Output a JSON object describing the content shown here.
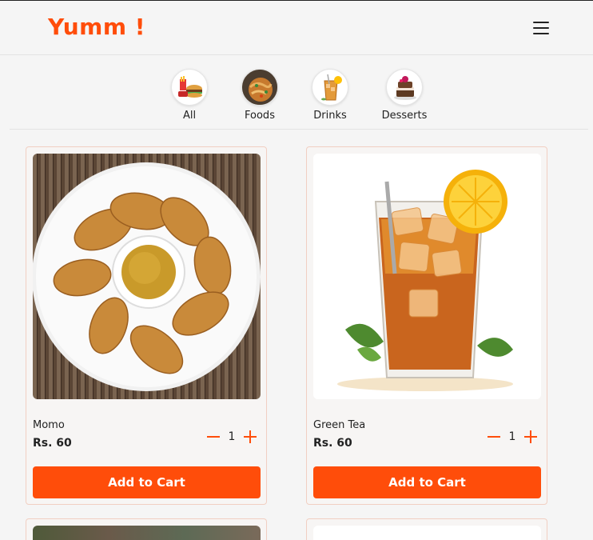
{
  "header": {
    "brand": "Yumm !",
    "menu_icon": "hamburger-menu-icon"
  },
  "categories": [
    {
      "label": "All",
      "icon": "all-food-icon"
    },
    {
      "label": "Foods",
      "icon": "foods-icon"
    },
    {
      "label": "Drinks",
      "icon": "drinks-icon"
    },
    {
      "label": "Desserts",
      "icon": "desserts-icon"
    }
  ],
  "products": [
    {
      "name": "Momo",
      "price": "Rs. 60",
      "quantity": "1",
      "add_label": "Add to Cart",
      "image": "momo-image"
    },
    {
      "name": "Green Tea",
      "price": "Rs. 60",
      "quantity": "1",
      "add_label": "Add to Cart",
      "image": "iced-tea-image"
    }
  ],
  "colors": {
    "accent": "#ff4d0a",
    "background": "#f5f5f5",
    "card_border": "#f1cfc2"
  }
}
